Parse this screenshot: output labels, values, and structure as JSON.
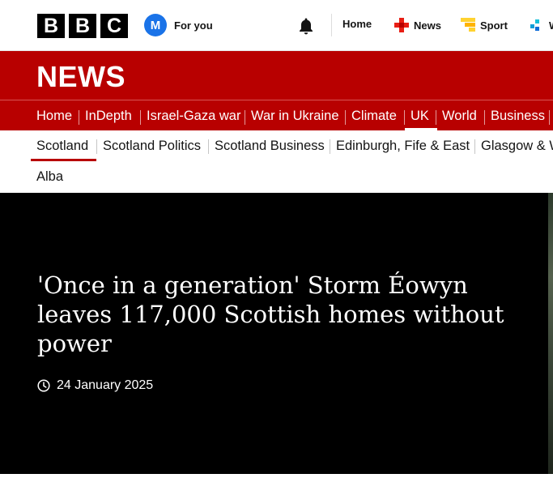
{
  "header": {
    "logo_letters": [
      "B",
      "B",
      "C"
    ],
    "avatar_initial": "M",
    "for_you_label": "For you",
    "notifications_icon": "bell-icon",
    "nav": [
      {
        "label": "Home",
        "icon": ""
      },
      {
        "label": "News",
        "icon": "news-icon",
        "color": "#e81e14"
      },
      {
        "label": "Sport",
        "icon": "sport-icon",
        "color": "#ffd230"
      },
      {
        "label": "W",
        "icon": "weather-icon",
        "color": "#0f9ed8"
      }
    ]
  },
  "banner": {
    "wordmark": "NEWS",
    "background": "#b80000"
  },
  "section_nav": {
    "items": [
      "Home",
      "InDepth",
      "Israel-Gaza war",
      "War in Ukraine",
      "Climate",
      "UK",
      "World",
      "Business"
    ],
    "active": "UK"
  },
  "sub_nav": {
    "items": [
      "Scotland",
      "Scotland Politics",
      "Scotland Business",
      "Edinburgh, Fife & East",
      "Glasgow & W",
      "Alba"
    ],
    "active": "Scotland",
    "accent": "#b80000"
  },
  "article": {
    "headline": "'Once in a generation' Storm Éowyn leaves 117,000 Scottish homes without power",
    "date": "24 January 2025"
  }
}
